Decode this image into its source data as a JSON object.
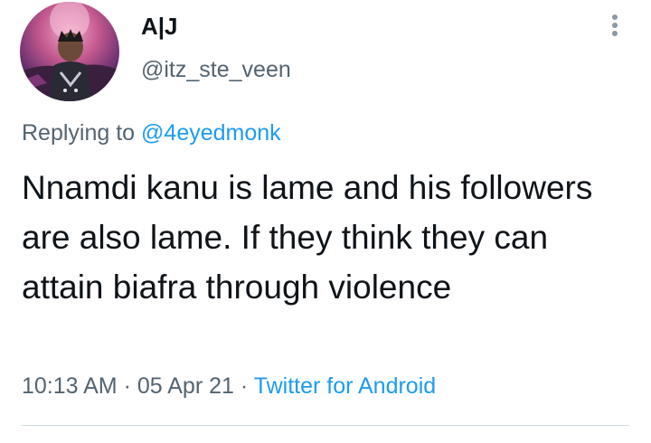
{
  "tweet": {
    "display_name": "A|J",
    "handle": "@itz_ste_veen",
    "replying_prefix": "Replying to",
    "replying_to": "@4eyedmonk",
    "text": "Nnamdi kanu is lame and his followers are also lame. If they think they can attain biafra through violence",
    "time": "10:13 AM",
    "separator": "·",
    "date": "05 Apr 21",
    "source": "Twitter for Android"
  },
  "colors": {
    "text": "#0f1419",
    "secondary": "#536471",
    "link": "#1d9bf0",
    "divider": "#cfd9de"
  },
  "icons": {
    "more": "vertical-ellipsis-icon"
  }
}
